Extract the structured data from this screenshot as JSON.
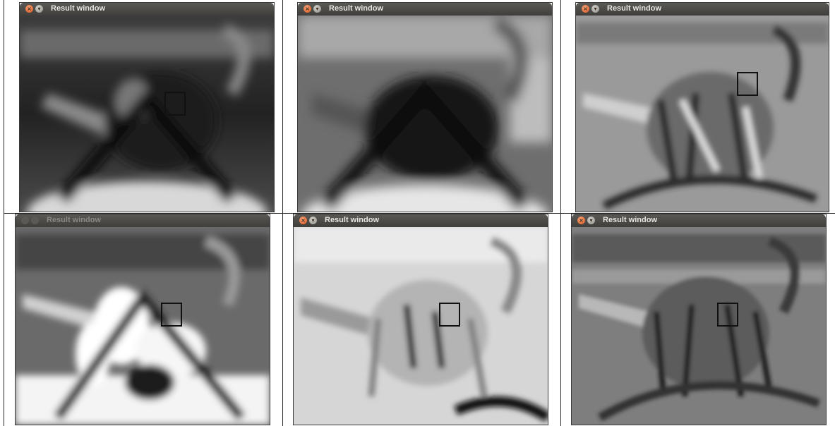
{
  "windows": [
    {
      "title": "Result window",
      "active": true,
      "tone": "dark"
    },
    {
      "title": "Result window",
      "active": true,
      "tone": "mid"
    },
    {
      "title": "Result window",
      "active": true,
      "tone": "edge"
    },
    {
      "title": "Result window",
      "active": false,
      "tone": "bright"
    },
    {
      "title": "Result window",
      "active": true,
      "tone": "light"
    },
    {
      "title": "Result window",
      "active": true,
      "tone": "textured"
    }
  ],
  "icons": {
    "close": "close-icon",
    "minimize": "minimize-icon"
  },
  "colors": {
    "titlebar_top": "#5a5955",
    "titlebar_bottom": "#3f3e3b",
    "close_button": "#e2602a",
    "title_text": "#e8e6e1",
    "grid_line": "#2a2a2a",
    "roi_box": "#111111"
  }
}
